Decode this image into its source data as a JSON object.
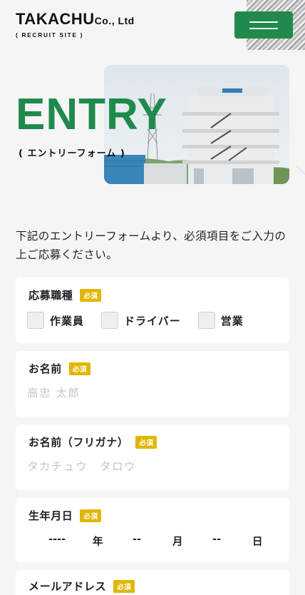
{
  "header": {
    "logo_main": "TAKACHU",
    "logo_co": "Co., Ltd",
    "logo_sub": "( RECRUIT SITE )",
    "menu_icon": "hamburger-icon"
  },
  "hero": {
    "title": "ENTRY",
    "subtitle": "( エントリーフォーム )",
    "building_sign": "TAKACHU"
  },
  "intro": "下記のエントリーフォームより、必須項目をご入力の上ご応募ください。",
  "form": {
    "job_type": {
      "label": "応募職種",
      "required": "必須",
      "options": [
        "作業員",
        "ドライバー",
        "営業"
      ]
    },
    "name": {
      "label": "お名前",
      "required": "必須",
      "placeholder": "高忠 太郎"
    },
    "name_kana": {
      "label": "お名前（フリガナ）",
      "required": "必須",
      "placeholder": "タカチュウ　タロウ"
    },
    "birthdate": {
      "label": "生年月日",
      "required": "必須",
      "year": "----",
      "year_unit": "年",
      "month": "--",
      "month_unit": "月",
      "day": "--",
      "day_unit": "日"
    },
    "email": {
      "label": "メールアドレス",
      "required": "必須"
    }
  },
  "colors": {
    "accent": "#1f8a4c",
    "required_badge": "#e1b600",
    "background": "#f5f5f5"
  }
}
